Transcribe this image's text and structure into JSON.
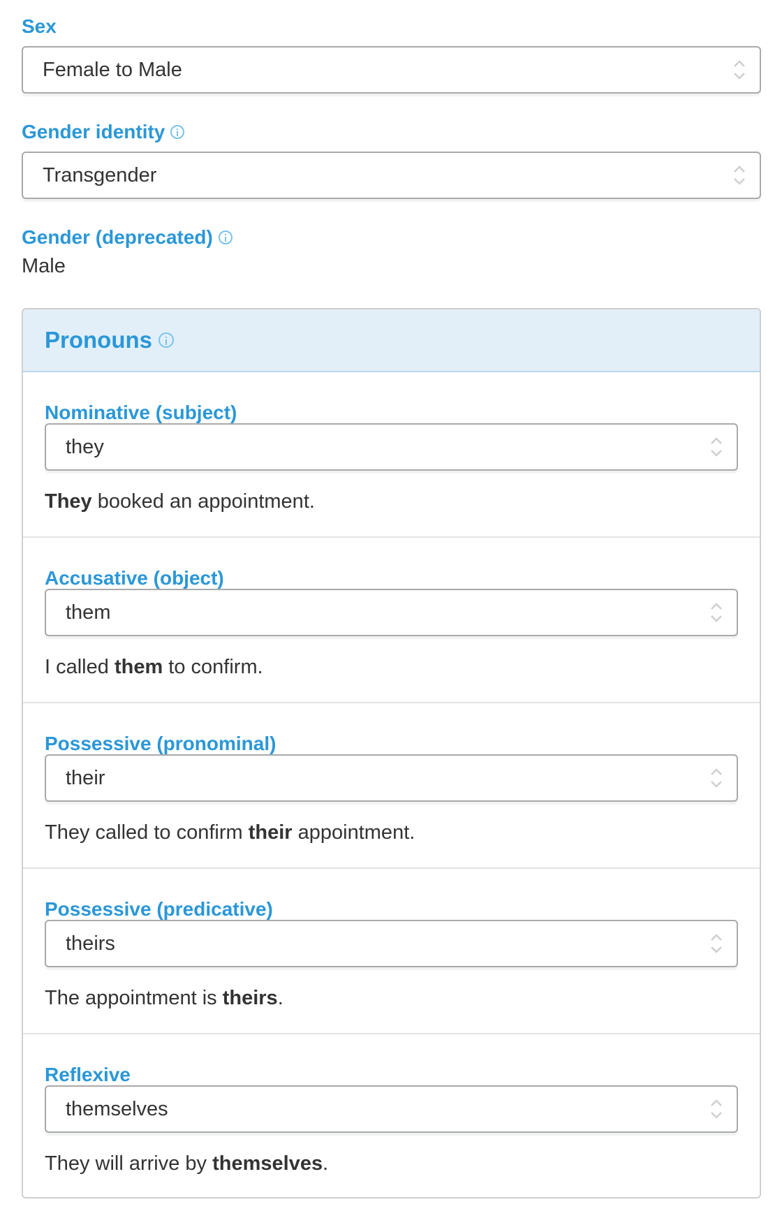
{
  "sex": {
    "label": "Sex",
    "value": "Female to Male"
  },
  "gender_identity": {
    "label": "Gender identity",
    "value": "Transgender",
    "info_icon": "info-circle-icon"
  },
  "gender_deprecated": {
    "label": "Gender (deprecated)",
    "value": "Male",
    "info_icon": "info-circle-icon"
  },
  "pronouns": {
    "title": "Pronouns",
    "info_icon": "info-circle-icon",
    "sections": [
      {
        "label": "Nominative (subject)",
        "value": "they",
        "example": {
          "before": "",
          "bold": "They",
          "after": " booked an appointment."
        }
      },
      {
        "label": "Accusative (object)",
        "value": "them",
        "example": {
          "before": "I called ",
          "bold": "them",
          "after": " to confirm."
        }
      },
      {
        "label": "Possessive (pronominal)",
        "value": "their",
        "example": {
          "before": "They called to confirm ",
          "bold": "their",
          "after": " appointment."
        }
      },
      {
        "label": "Possessive (predicative)",
        "value": "theirs",
        "example": {
          "before": "The appointment is ",
          "bold": "theirs",
          "after": "."
        }
      },
      {
        "label": "Reflexive",
        "value": "themselves",
        "example": {
          "before": "They will arrive by ",
          "bold": "themselves",
          "after": "."
        }
      }
    ]
  },
  "colors": {
    "label_blue": "#2a97d8",
    "info_icon": "#79c3ec",
    "panel_header_bg": "#e2eff9",
    "text": "#333333"
  }
}
